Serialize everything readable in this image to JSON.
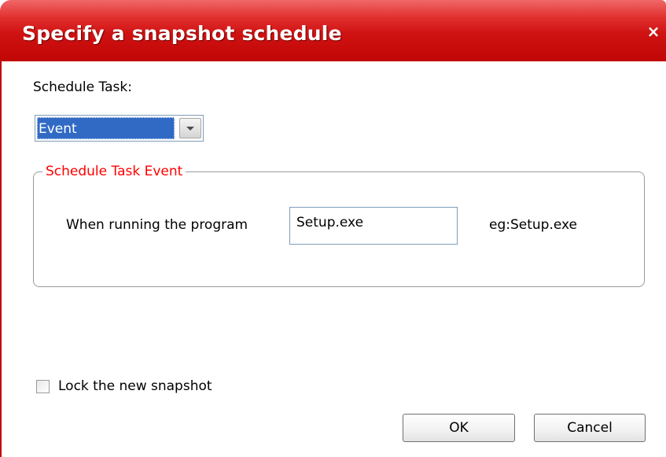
{
  "window": {
    "title": "Specify a snapshot schedule",
    "close_symbol": "×"
  },
  "schedule": {
    "label": "Schedule Task:",
    "selected_value": "Event"
  },
  "event_group": {
    "legend": "Schedule Task Event",
    "program_label": "When running the program",
    "program_value": "Setup.exe",
    "example_hint": "eg:Setup.exe"
  },
  "lock": {
    "label": "Lock the new snapshot",
    "checked": false
  },
  "buttons": {
    "ok_label": "OK",
    "cancel_label": "Cancel"
  },
  "colors": {
    "titlebar": "#cf1212",
    "legend_text": "#ff0000",
    "selection": "#316ac5"
  },
  "icons": {
    "close": "close-icon",
    "dropdown": "chevron-down-icon"
  }
}
